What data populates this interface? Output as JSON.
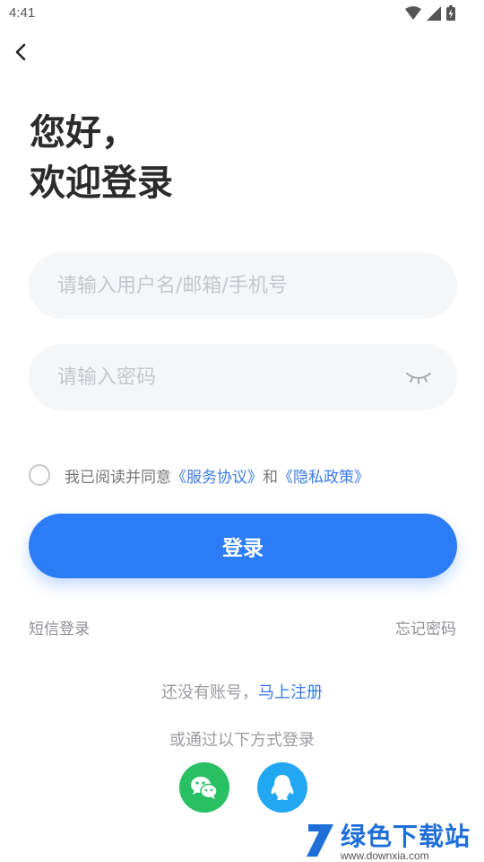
{
  "status_bar": {
    "time": "4:41"
  },
  "header": {
    "back_icon": "chevron-left-icon"
  },
  "greeting": {
    "line1": "您好，",
    "line2": "欢迎登录"
  },
  "form": {
    "username_placeholder": "请输入用户名/邮箱/手机号",
    "username_value": "",
    "password_placeholder": "请输入密码",
    "password_value": "",
    "password_toggle_icon": "eye-closed-icon"
  },
  "agreement": {
    "checked": false,
    "prefix": "我已阅读并同意",
    "terms_link": "《服务协议》",
    "conjunction": "和",
    "privacy_link": "《隐私政策》"
  },
  "login_button": {
    "label": "登录",
    "color": "#2b7cf6"
  },
  "links": {
    "sms_login": "短信登录",
    "forgot_password": "忘记密码"
  },
  "register": {
    "prompt": "还没有账号，",
    "link": "马上注册"
  },
  "third_party": {
    "title": "或通过以下方式登录",
    "providers": [
      {
        "icon": "wechat-icon",
        "color": "#28c062"
      },
      {
        "icon": "qq-icon",
        "color": "#22a8f3"
      }
    ]
  },
  "watermark": {
    "name": "绿色下载站",
    "url": "www.downxia.com"
  }
}
